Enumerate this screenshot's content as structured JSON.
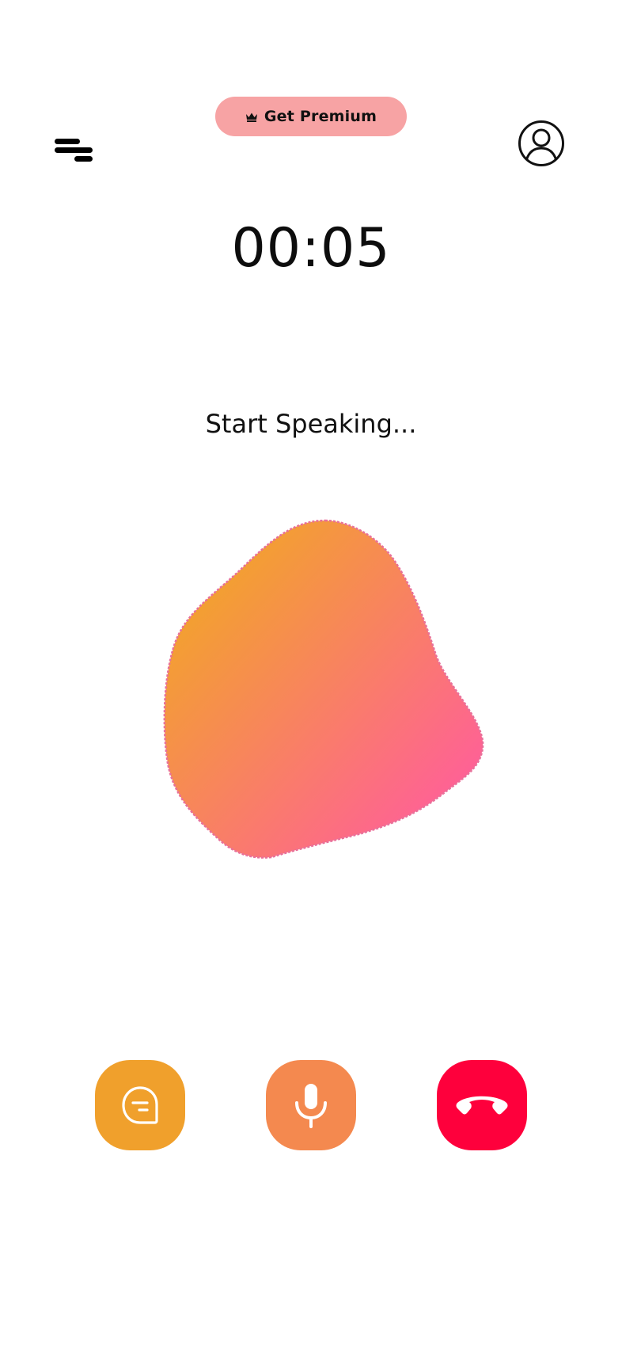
{
  "header": {
    "premium_label": "Get Premium"
  },
  "call": {
    "timer": "00:05",
    "status": "Start Speaking..."
  },
  "icons": {
    "menu": "menu-icon",
    "crown": "crown-icon",
    "profile": "user-profile-icon",
    "chat": "chat-bubble-icon",
    "mic": "microphone-icon",
    "end_call": "phone-hangup-icon"
  },
  "colors": {
    "premium_bg": "#F7A3A4",
    "chat_button": "#F0A02C",
    "mic_button": "#F4894F",
    "end_call_button": "#FE003C",
    "blob_gradient_start": "#F2A42A",
    "blob_gradient_end": "#FF5E9B"
  }
}
